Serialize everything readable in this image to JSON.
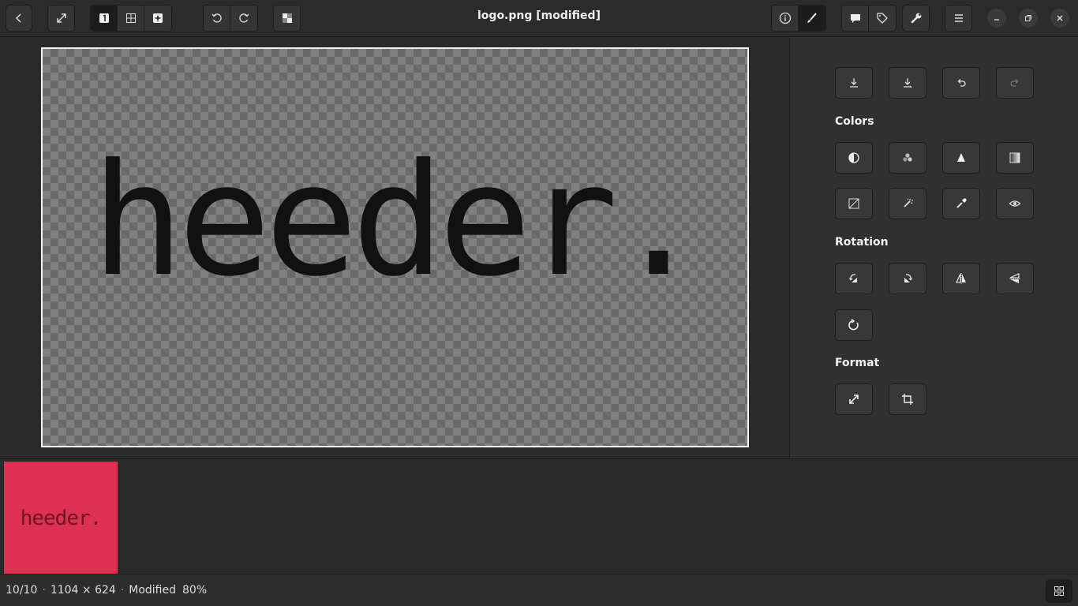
{
  "window": {
    "title": "logo.png [modified]"
  },
  "header": {
    "back_icon": "go-back-icon",
    "fullscreen_icon": "fullscreen-icon",
    "view_modes": [
      "single-view-icon",
      "gallery-view-icon",
      "add-icon"
    ],
    "rotate_icons": [
      "rotate-left-icon",
      "rotate-right-icon"
    ],
    "transparency_icon": "transparency-checker-icon",
    "panel_toggles": [
      "info-icon",
      "edit-brush-icon"
    ],
    "extra_toggles": [
      "comment-icon",
      "tag-icon"
    ],
    "tools_icon": "wrench-icon",
    "menu_icon": "hamburger-menu-icon"
  },
  "canvas": {
    "text": "heeder."
  },
  "panel": {
    "top_actions": [
      "save-icon",
      "save-as-icon",
      "undo-icon",
      "redo-icon"
    ],
    "colors_label": "Colors",
    "rotation_label": "Rotation",
    "format_label": "Format"
  },
  "thumbnail": {
    "text": "heeder.",
    "color": "#de3051"
  },
  "status": {
    "position": "10/10",
    "dimensions": "1104 × 624",
    "state": "Modified",
    "zoom": "80%",
    "separator": "·"
  }
}
